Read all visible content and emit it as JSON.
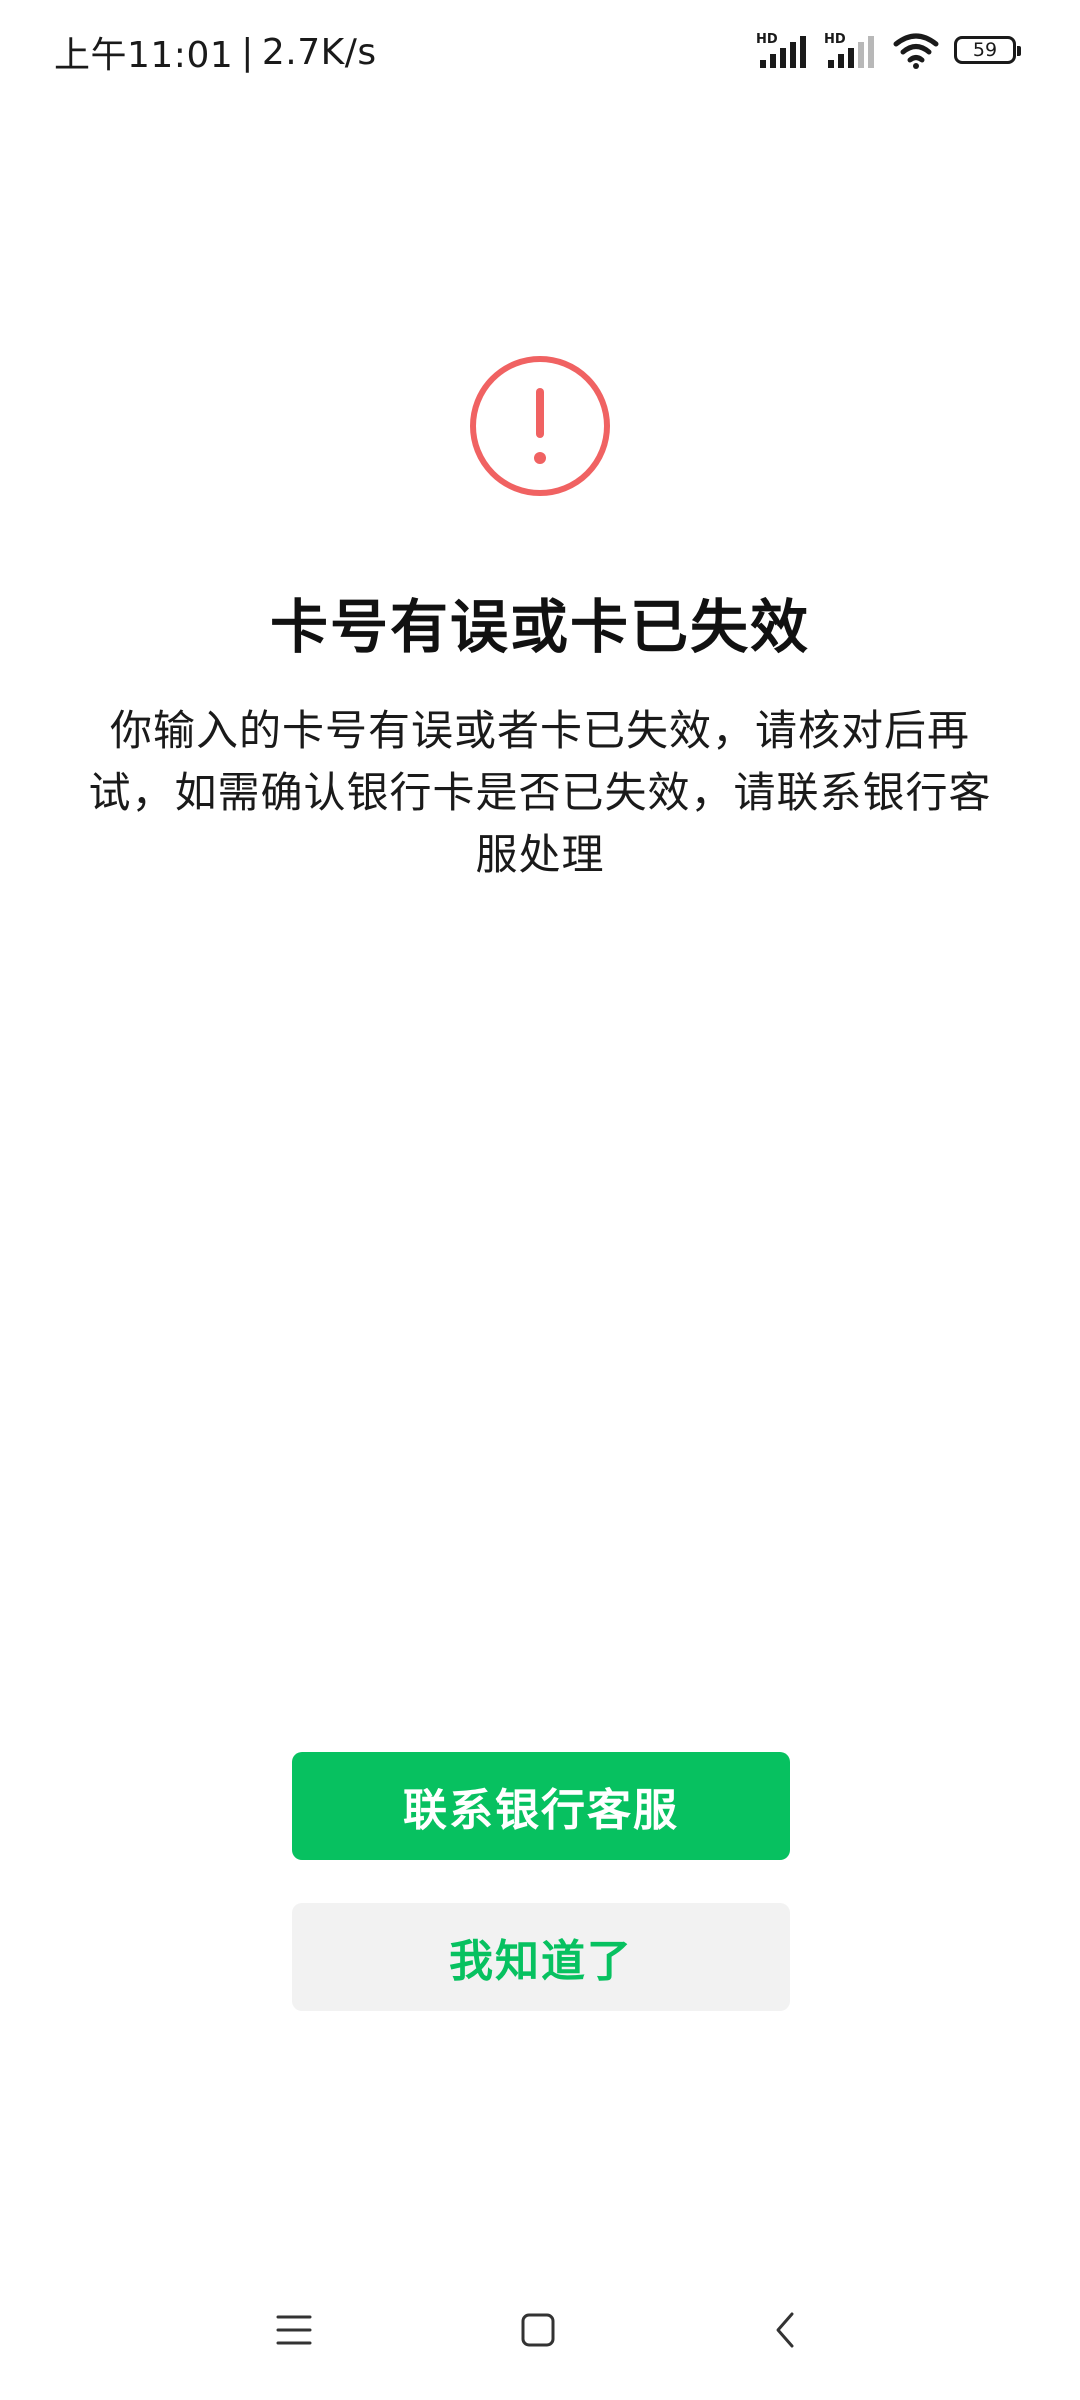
{
  "status_bar": {
    "time": "上午11:01",
    "separator": "|",
    "network_speed": "2.7K/s",
    "signal1_label": "HD",
    "signal2_label": "HD",
    "battery_level": "59",
    "icons": [
      "hd-signal-icon",
      "hd-signal-icon",
      "wifi-icon",
      "battery-icon"
    ]
  },
  "error": {
    "icon": "exclamation-circle-icon",
    "color": "#f06262",
    "title": "卡号有误或卡已失效",
    "message": "你输入的卡号有误或者卡已失效，请核对后再试，如需确认银行卡是否已失效，请联系银行客服处理"
  },
  "actions": {
    "primary_label": "联系银行客服",
    "secondary_label": "我知道了",
    "accent_color": "#07c160",
    "secondary_bg": "#f2f2f2"
  },
  "navigation": {
    "icons": [
      "menu-icon",
      "home-icon",
      "back-icon"
    ]
  }
}
